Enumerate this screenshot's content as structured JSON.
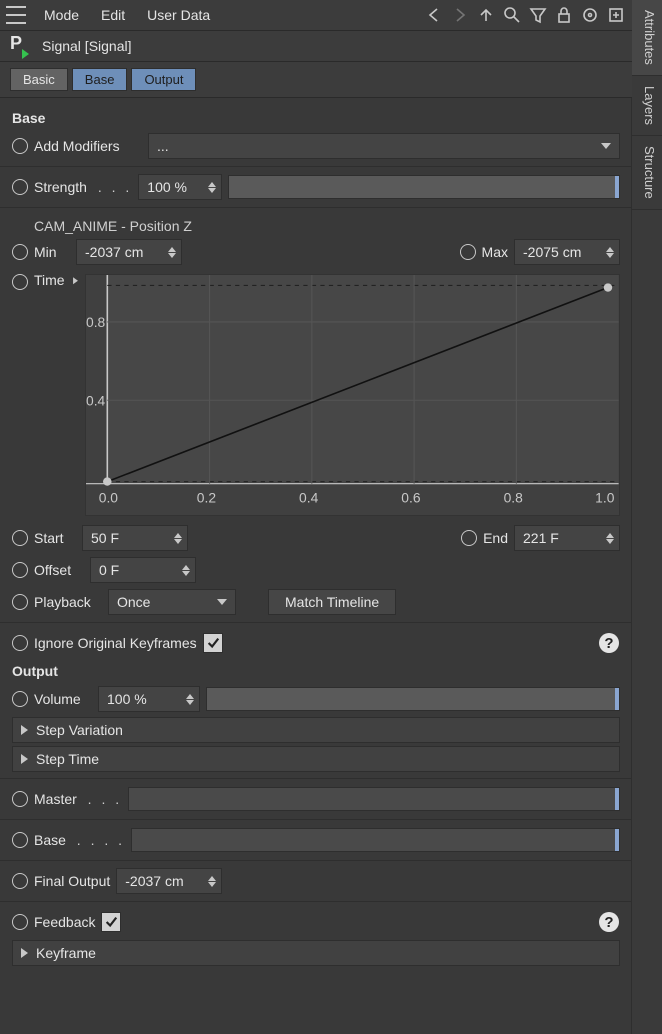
{
  "menu": {
    "mode": "Mode",
    "edit": "Edit",
    "userdata": "User Data"
  },
  "sidepanels": {
    "attributes": "Attributes",
    "layers": "Layers",
    "structure": "Structure"
  },
  "object_title": "Signal [Signal]",
  "tabs": {
    "basic": "Basic",
    "base": "Base",
    "output": "Output"
  },
  "base": {
    "header": "Base",
    "add_modifiers_label": "Add Modifiers",
    "add_modifiers_value": "...",
    "strength_label": "Strength",
    "strength_value": "100 %",
    "track_name": "CAM_ANIME - Position Z",
    "min_label": "Min",
    "min_value": "-2037 cm",
    "max_label": "Max",
    "max_value": "-2075 cm",
    "time_label": "Time",
    "start_label": "Start",
    "start_value": "50 F",
    "end_label": "End",
    "end_value": "221 F",
    "offset_label": "Offset",
    "offset_value": "0 F",
    "playback_label": "Playback",
    "playback_value": "Once",
    "match_timeline": "Match Timeline",
    "ignore_label": "Ignore Original Keyframes"
  },
  "output": {
    "header": "Output",
    "volume_label": "Volume",
    "volume_value": "100 %",
    "step_variation": "Step Variation",
    "step_time": "Step Time",
    "master_label": "Master",
    "base_label": "Base",
    "final_label": "Final Output",
    "final_value": "-2037 cm",
    "feedback_label": "Feedback",
    "keyframe": "Keyframe"
  },
  "chart_data": {
    "type": "line",
    "x": [
      0.0,
      1.0
    ],
    "y": [
      0.0,
      1.0
    ],
    "xticks": [
      0.0,
      0.2,
      0.4,
      0.6,
      0.8,
      1.0
    ],
    "yticks": [
      0.4,
      0.8
    ],
    "xlim": [
      0,
      1
    ],
    "ylim": [
      0,
      1
    ]
  }
}
